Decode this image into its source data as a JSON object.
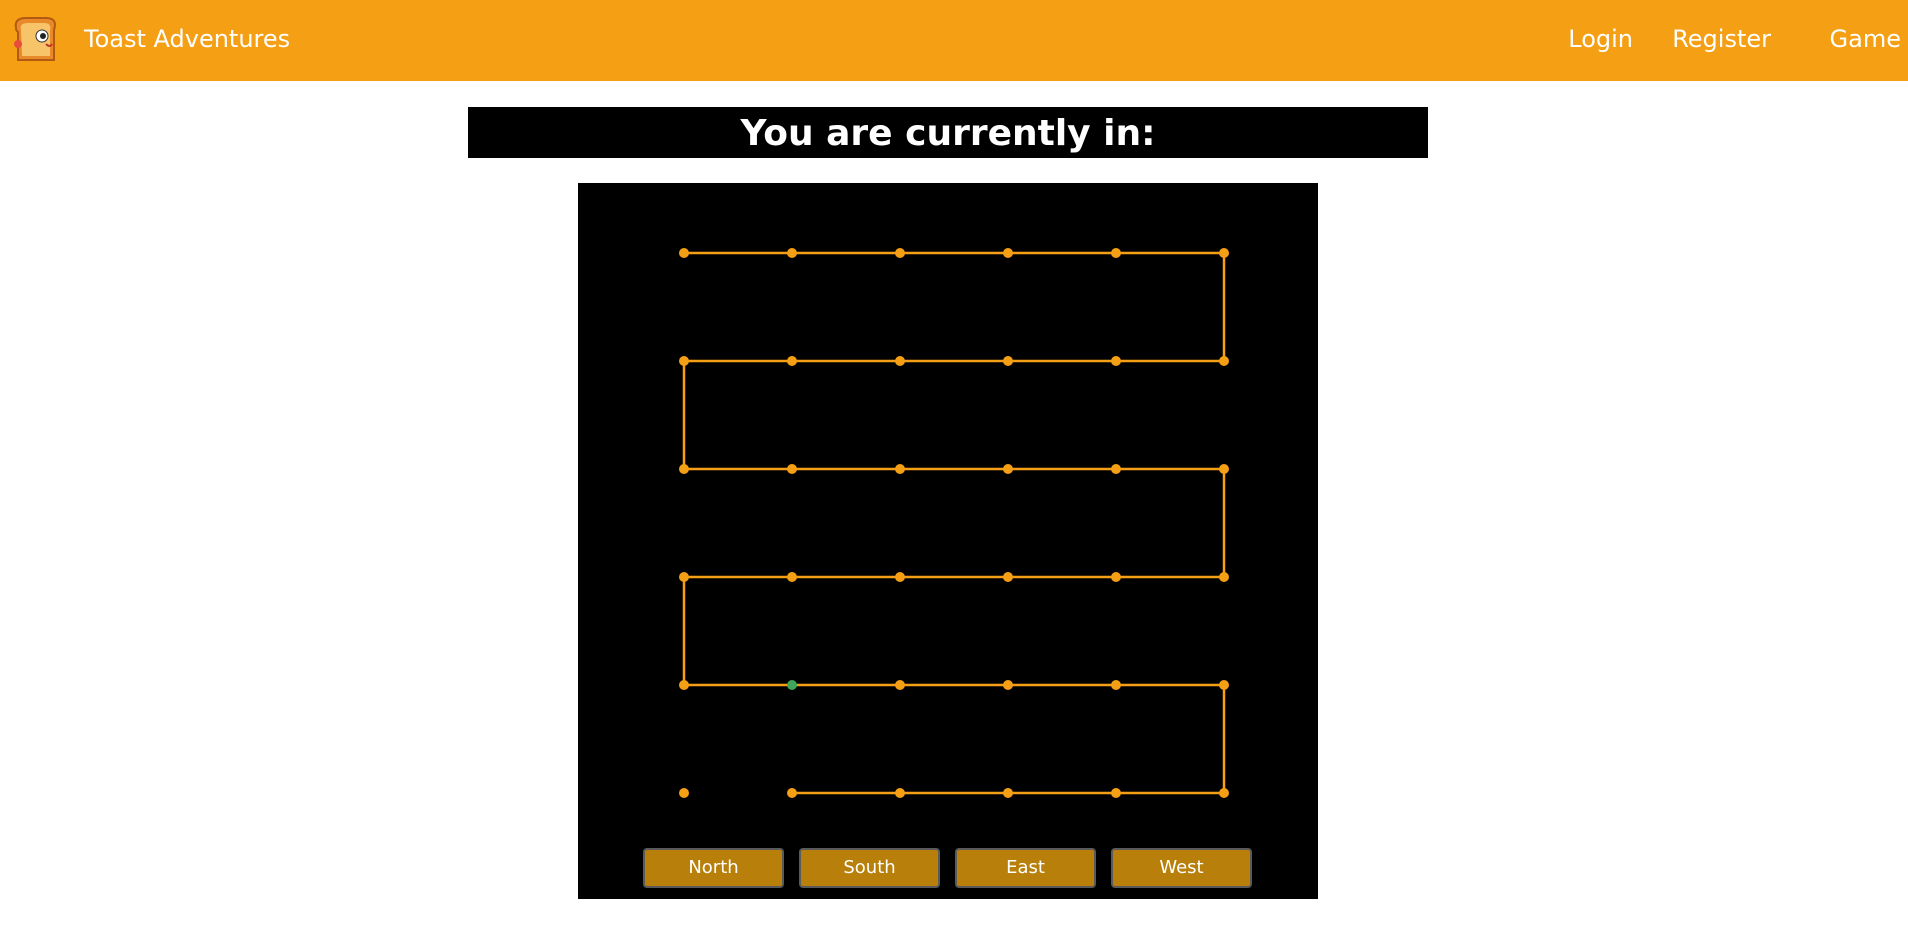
{
  "navbar": {
    "brand": "Toast Adventures",
    "logo_icon": "toast-logo-icon",
    "links": {
      "login": "Login",
      "register": "Register",
      "game": "Game"
    },
    "color": "#f59f14"
  },
  "location": {
    "label": "You are currently in:"
  },
  "map": {
    "path_color": "#f59f14",
    "current_color": "#3fa75a",
    "rows": 6,
    "cols": 6,
    "path": [
      [
        0,
        0
      ],
      [
        1,
        0
      ],
      [
        2,
        0
      ],
      [
        3,
        0
      ],
      [
        4,
        0
      ],
      [
        5,
        0
      ],
      [
        5,
        1
      ],
      [
        4,
        1
      ],
      [
        3,
        1
      ],
      [
        2,
        1
      ],
      [
        1,
        1
      ],
      [
        0,
        1
      ],
      [
        0,
        2
      ],
      [
        1,
        2
      ],
      [
        2,
        2
      ],
      [
        3,
        2
      ],
      [
        4,
        2
      ],
      [
        5,
        2
      ],
      [
        5,
        3
      ],
      [
        4,
        3
      ],
      [
        3,
        3
      ],
      [
        2,
        3
      ],
      [
        1,
        3
      ],
      [
        0,
        3
      ],
      [
        0,
        4
      ],
      [
        1,
        4
      ],
      [
        2,
        4
      ],
      [
        3,
        4
      ],
      [
        4,
        4
      ],
      [
        5,
        4
      ],
      [
        5,
        5
      ],
      [
        4,
        5
      ],
      [
        3,
        5
      ],
      [
        2,
        5
      ],
      [
        1,
        5
      ]
    ],
    "isolated_nodes": [
      [
        0,
        5
      ]
    ],
    "current_node": [
      1,
      4
    ]
  },
  "controls": {
    "north": "North",
    "south": "South",
    "east": "East",
    "west": "West"
  }
}
